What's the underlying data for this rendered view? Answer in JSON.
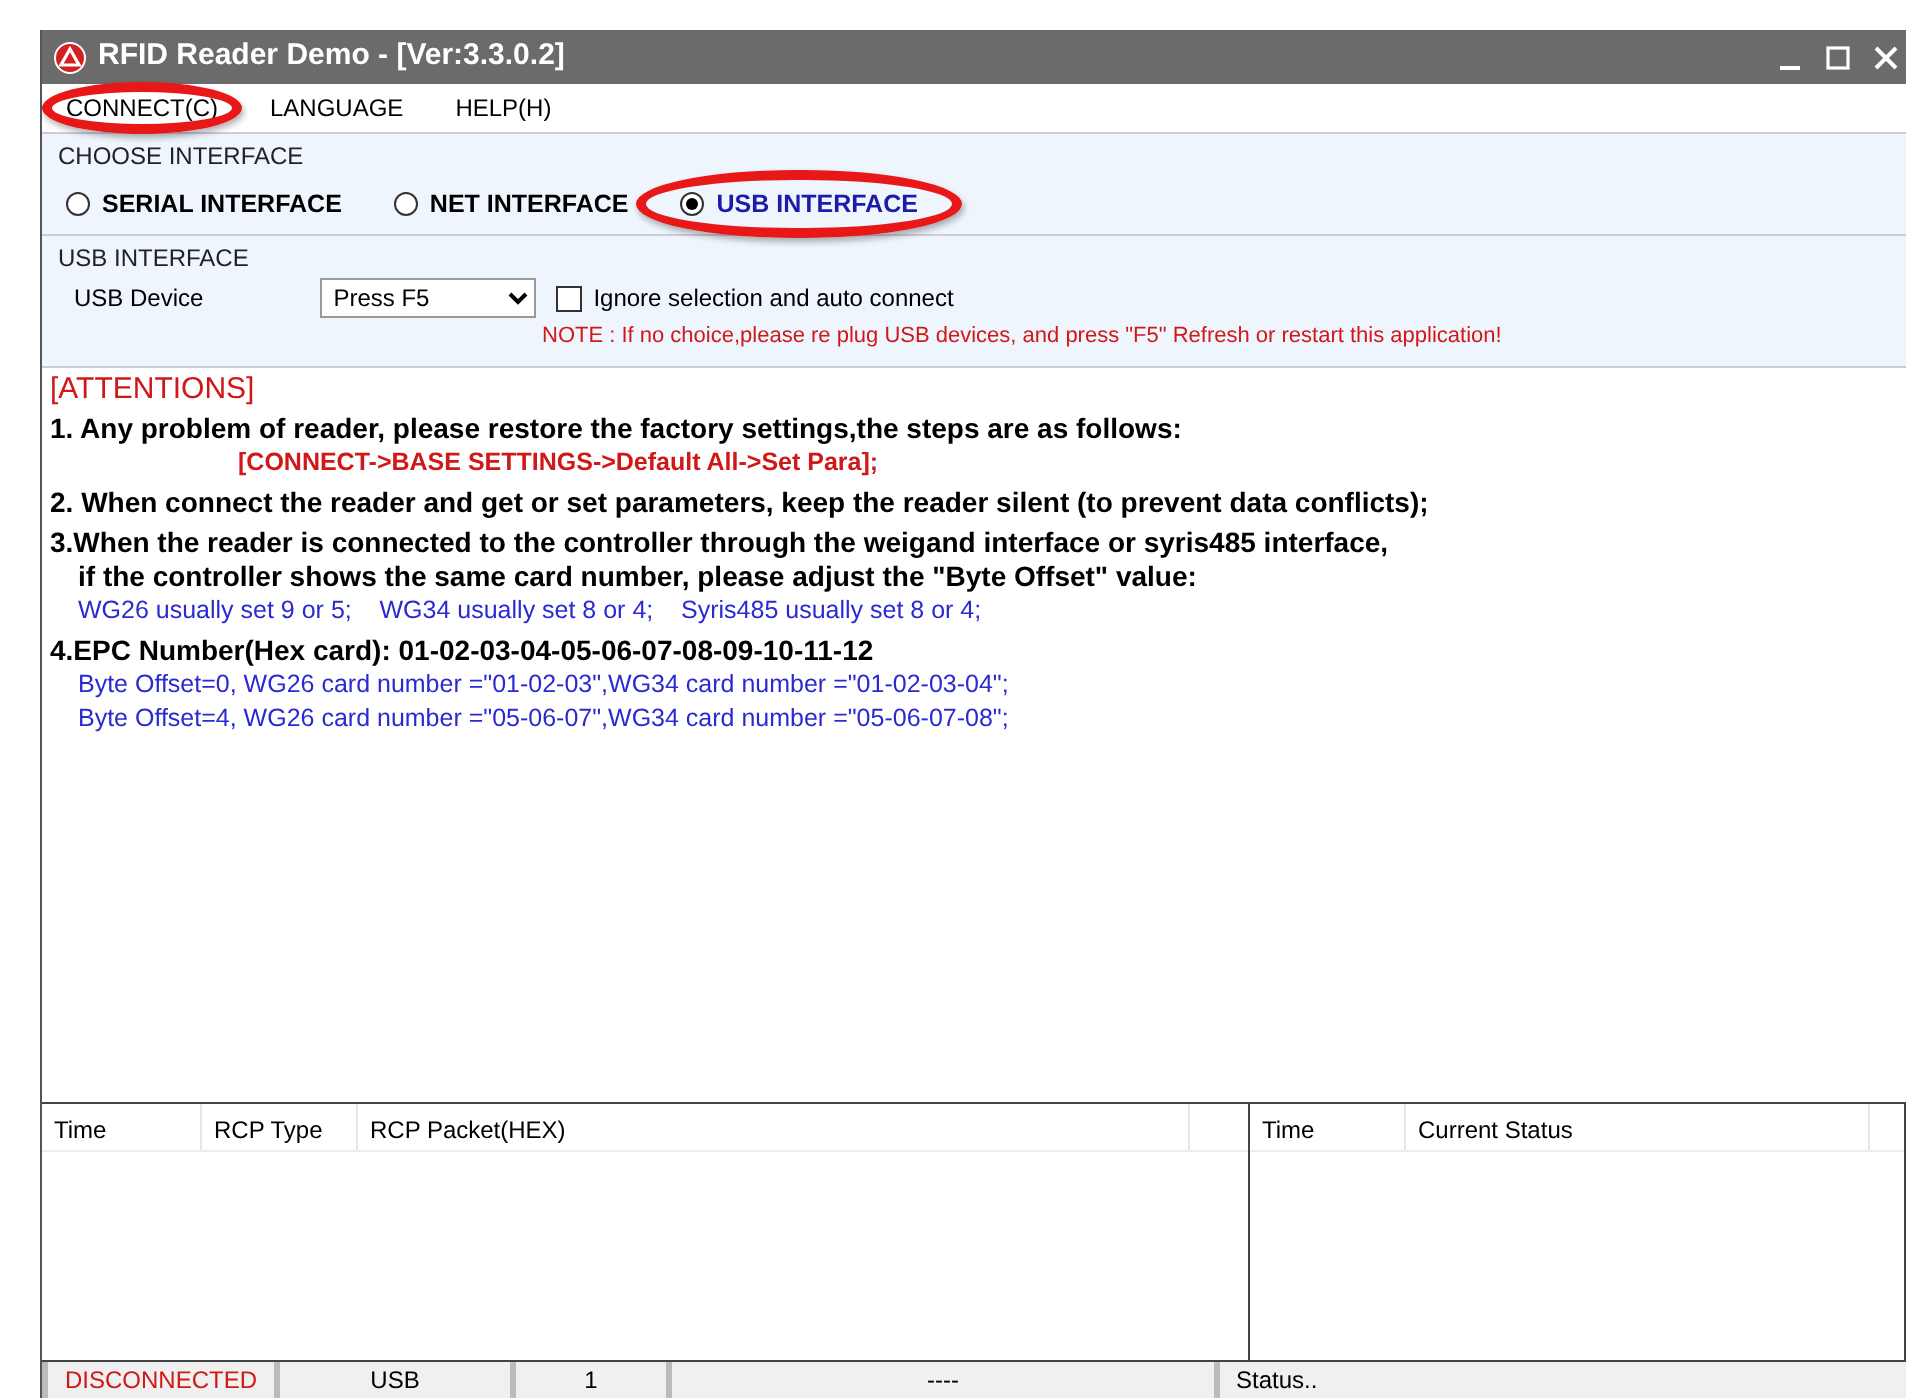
{
  "window": {
    "title": "RFID Reader Demo - [Ver:3.3.0.2]"
  },
  "menu": [
    {
      "label": "CONNECT(C)",
      "highlighted": true
    },
    {
      "label": "LANGUAGE",
      "highlighted": false
    },
    {
      "label": "HELP(H)",
      "highlighted": false
    }
  ],
  "interface_group": {
    "title": "CHOOSE INTERFACE",
    "options": [
      {
        "label": "SERIAL INTERFACE",
        "selected": false,
        "highlighted": false
      },
      {
        "label": "NET INTERFACE",
        "selected": false,
        "highlighted": false
      },
      {
        "label": "USB INTERFACE",
        "selected": true,
        "highlighted": true
      }
    ]
  },
  "usb_group": {
    "title": "USB INTERFACE",
    "device_label": "USB Device",
    "device_value": "Press F5",
    "auto_connect": {
      "label": "Ignore selection and auto connect",
      "checked": false
    },
    "note": "NOTE : If no choice,please re plug USB devices, and press \"F5\" Refresh or restart this application!"
  },
  "attentions": [
    {
      "kind": "heading",
      "text": "[ATTENTIONS]"
    },
    {
      "kind": "step",
      "text": "1. Any problem of reader, please restore the factory settings,the steps are as follows:"
    },
    {
      "kind": "command",
      "text": "[CONNECT->BASE SETTINGS->Default All->Set Para];"
    },
    {
      "kind": "step",
      "text": "2. When connect the reader and get or set parameters, keep the reader silent (to prevent data conflicts);"
    },
    {
      "kind": "step",
      "text": "3.When the reader is connected to the controller through the weigand interface or syris485 interface,"
    },
    {
      "kind": "substep",
      "text": "if the controller shows the same card number, please adjust the \"Byte Offset\" value:"
    },
    {
      "kind": "detail",
      "text": "WG26 usually set 9 or 5;    WG34 usually set 8 or 4;    Syris485 usually set 8 or 4;"
    },
    {
      "kind": "step",
      "text": "4.EPC Number(Hex card): 01-02-03-04-05-06-07-08-09-10-11-12"
    },
    {
      "kind": "detail",
      "text": "Byte Offset=0, WG26 card number =\"01-02-03\",WG34 card number =\"01-02-03-04\";"
    },
    {
      "kind": "detail",
      "text": "Byte Offset=4, WG26 card number =\"05-06-07\",WG34 card number =\"05-06-07-08\";"
    }
  ],
  "packet_table": {
    "columns": [
      "Time",
      "RCP Type",
      "RCP Packet(HEX)"
    ]
  },
  "status_table": {
    "columns": [
      "Time",
      "Current Status"
    ]
  },
  "status_bar": [
    {
      "text": "DISCONNECTED",
      "kind": "error"
    },
    {
      "text": "USB",
      "kind": "normal"
    },
    {
      "text": "1",
      "kind": "normal"
    },
    {
      "text": "----",
      "kind": "normal"
    },
    {
      "text": "Status..",
      "kind": "left"
    }
  ]
}
